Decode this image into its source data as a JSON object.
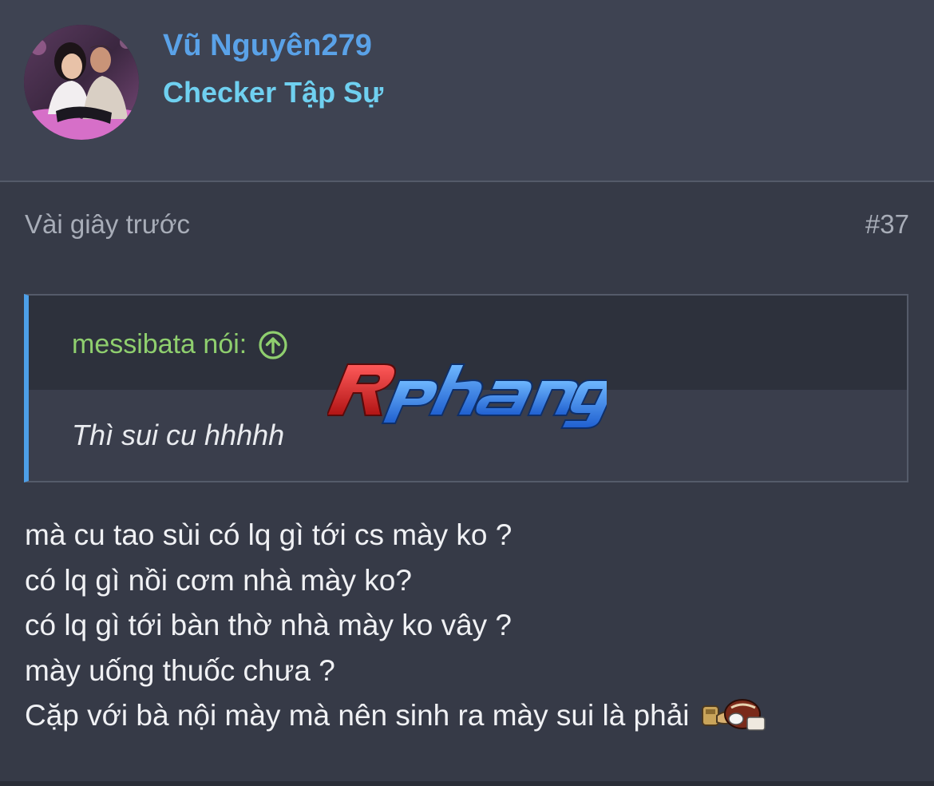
{
  "post": {
    "user": {
      "name": "Vũ Nguyên279",
      "title": "Checker Tập Sự"
    },
    "timestamp": "Vài giây trước",
    "number": "#37",
    "quote": {
      "author": "messibata nói:",
      "text": "Thì sui cu hhhhh"
    },
    "message_lines": [
      "mà cu tao sùi có lq gì tới cs mày ko ?",
      "có lq gì nồi cơm nhà mày ko?",
      "có lq gì tới bàn thờ nhà mày ko vây ?",
      "mày uống thuốc chưa ?",
      "Cặp với bà nội mày mà nên sinh ra mày sui là phải"
    ],
    "emoji": "smiley-sticker-icon"
  },
  "watermark": {
    "text": "Rphang",
    "icon": "rphang-logo"
  },
  "colors": {
    "header_bg": "#3e4352",
    "page_bg": "#363a47",
    "username": "#5aa2e8",
    "user_title": "#6fd0f0",
    "quote_author": "#8fcf6e",
    "quote_border": "#4d9fe8"
  }
}
